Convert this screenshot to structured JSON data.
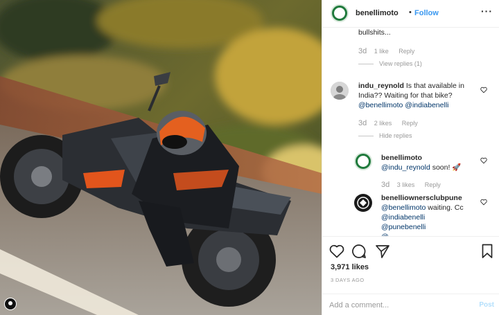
{
  "post": {
    "photo_alt": "",
    "account": "benellimoto",
    "separator": "•",
    "follow_label": "Follow",
    "more_label": "···"
  },
  "comments": {
    "partial_text": "bullshits...",
    "first_meta": {
      "age": "3d",
      "likes": "1 like",
      "reply": "Reply"
    },
    "first_view_replies": "View replies (1)",
    "c2": {
      "user": "indu_reynold",
      "text": "Is there that available in India?? Waiting for that bike?",
      "line1": "Is that available in",
      "line2": "India?? Waiting for that bike?",
      "mention1": "@benellimoto",
      "mention2": "@indiabenelli",
      "age": "3d",
      "likes": "2 likes",
      "reply": "Reply",
      "hide_replies": "Hide replies"
    },
    "r1": {
      "user": "benellimoto",
      "mention": "@indu_reynold",
      "text": " soon!",
      "emoji": "🚀",
      "age": "3d",
      "likes": "3 likes",
      "reply": "Reply"
    },
    "r2": {
      "user": "benelliownersclubpune",
      "mention1": "@benellimoto",
      "text": " waiting. Cc",
      "mention2": "@indiabenelli",
      "mention3": "@punebenelli",
      "cut_text": "@..."
    }
  },
  "actions": {
    "likes": "3,971 likes",
    "posted_ago": "3 DAYS AGO",
    "add_comment_placeholder": "Add a comment...",
    "post_label": "Post"
  },
  "colors": {
    "link_blue": "#3897f0",
    "mention_dark": "#003569",
    "muted": "#999999",
    "brand_green": "#1f7a3c"
  }
}
